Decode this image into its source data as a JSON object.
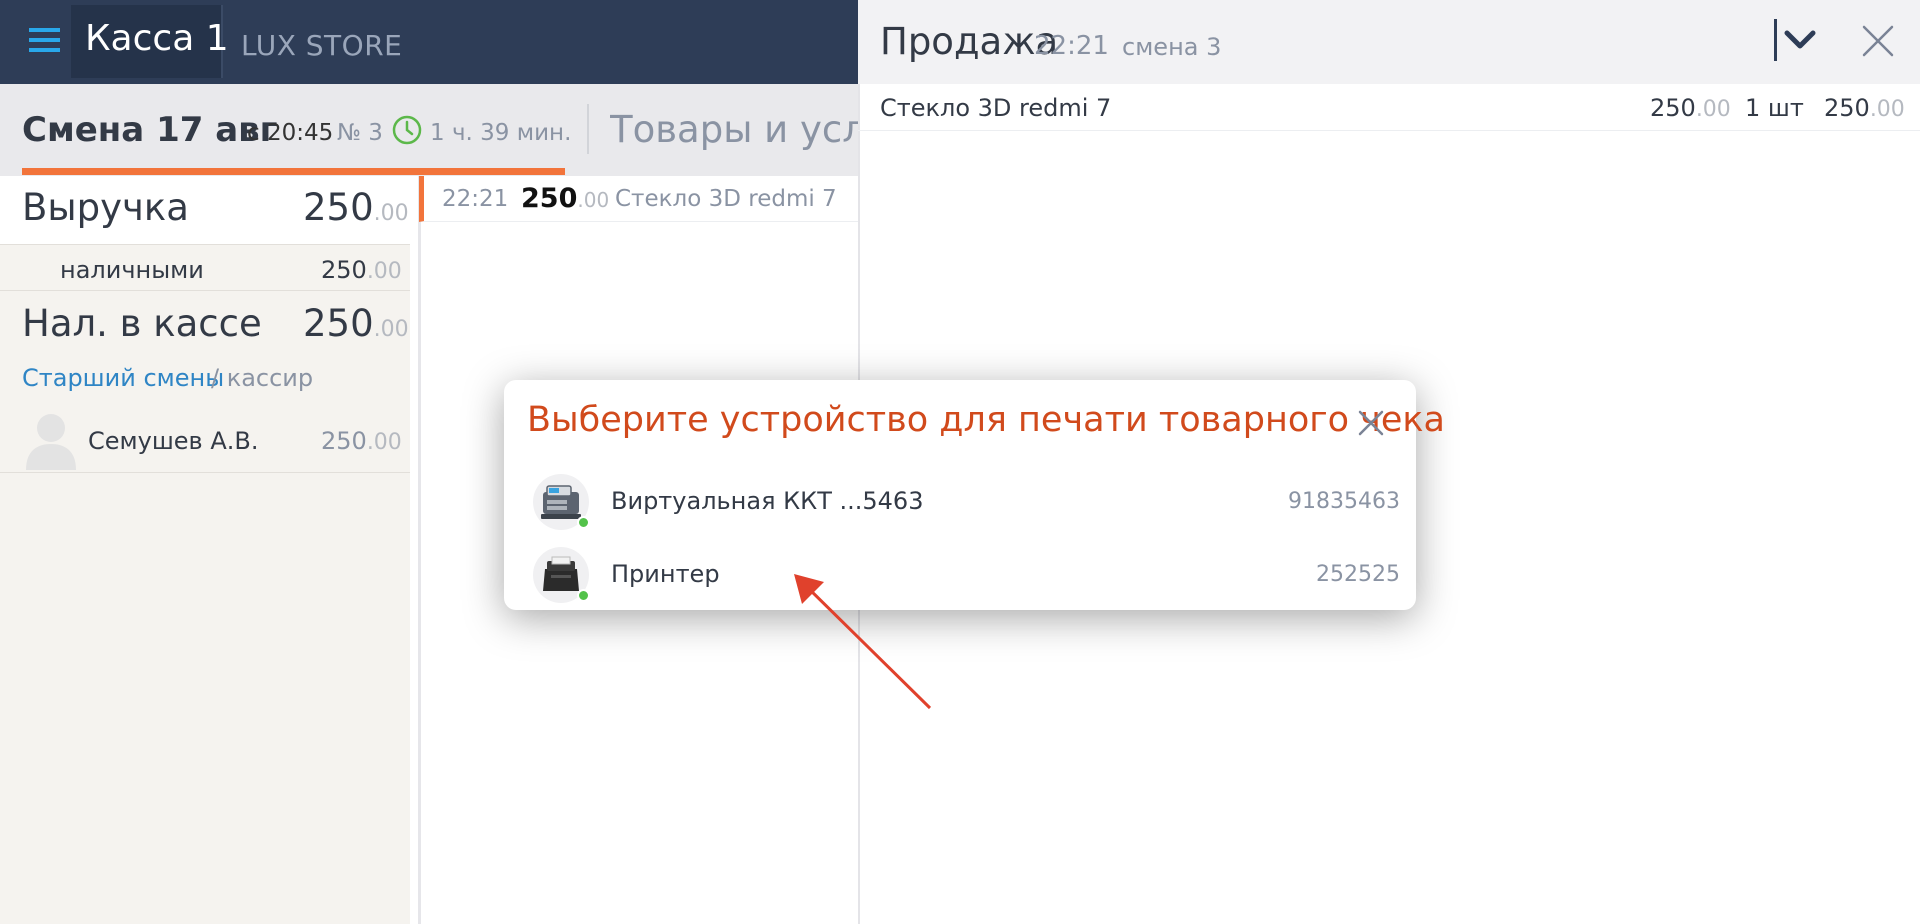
{
  "header": {
    "kassa_title": "Касса 1",
    "store_name": "LUX STORE"
  },
  "shift": {
    "title": "Смена 17 авг",
    "from": "с 20:45",
    "number": "№ 3",
    "duration": "1 ч. 39 мин.",
    "goods_tab": "Товары и услуги"
  },
  "summary": {
    "revenue_label": "Выручка",
    "revenue_amount": "250",
    "revenue_cents": ".00",
    "cash_label": "наличными",
    "cash_amount": "250",
    "cash_cents": ".00",
    "in_till_label": "Нал. в кассе",
    "in_till_amount": "250",
    "in_till_cents": ".00",
    "senior_label": "Старший смены",
    "cashier_label": "/ кассир",
    "employee_name": "Семушев А.В.",
    "employee_amount": "250",
    "employee_cents": ".00"
  },
  "receipts": [
    {
      "time": "22:21",
      "amount": "250",
      "cents": ".00",
      "name": "Стекло 3D redmi 7"
    }
  ],
  "sale": {
    "title": "Продажа",
    "time": "22:21",
    "shift": "смена 3",
    "items": [
      {
        "name": "Стекло 3D redmi 7",
        "price": "250",
        "price_cents": ".00",
        "qty": "1 шт",
        "total": "250",
        "total_cents": ".00"
      }
    ]
  },
  "modal": {
    "title": "Выберите устройство для печати товарного чека",
    "devices": [
      {
        "name": "Виртуальная ККТ ...5463",
        "serial": "91835463",
        "icon": "cash-register-icon",
        "status": "online"
      },
      {
        "name": "Принтер",
        "serial": "252525",
        "icon": "receipt-printer-icon",
        "status": "online"
      }
    ]
  },
  "colors": {
    "topbar": "#2e3d57",
    "accent_orange": "#f2743b",
    "modal_title": "#d14a1c",
    "link_blue": "#2f85c5",
    "online_green": "#53c24a",
    "burger_blue": "#29a8ea",
    "clock_green": "#5cb84a",
    "annotation_arrow": "#e0412c"
  }
}
